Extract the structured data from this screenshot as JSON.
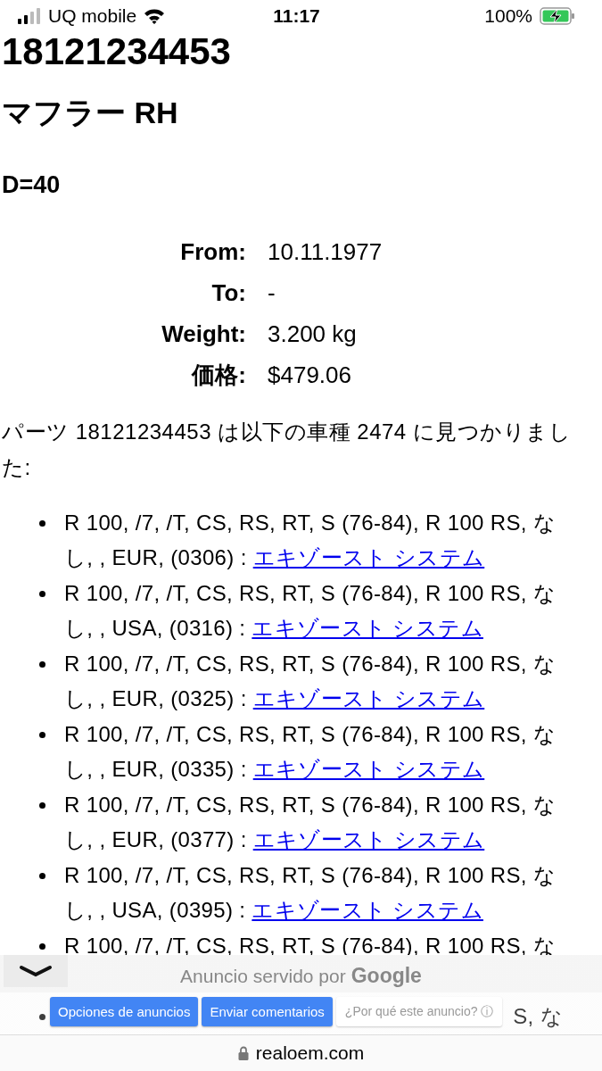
{
  "status_bar": {
    "carrier": "UQ mobile",
    "time": "11:17",
    "battery": "100%"
  },
  "part_number": "18121234453",
  "part_name": "マフラー RH",
  "note": "D=40",
  "details": [
    {
      "label": "From:",
      "value": "10.11.1977"
    },
    {
      "label": "To:",
      "value": "-"
    },
    {
      "label": "Weight:",
      "value": "3.200 kg"
    },
    {
      "label": "価格:",
      "value": "$479.06"
    }
  ],
  "intro": "パーツ 18121234453 は以下の車種 2474 に見つかりました:",
  "models": [
    {
      "text": "R 100, /7, /T, CS, RS, RT, S (76-84), R 100 RS, なし, , EUR, (0306) :",
      "link": "エキゾースト システム "
    },
    {
      "text": "R 100, /7, /T, CS, RS, RT, S (76-84), R 100 RS, なし, , USA, (0316) :",
      "link": "エキゾースト システム "
    },
    {
      "text": "R 100, /7, /T, CS, RS, RT, S (76-84), R 100 RS, なし, , EUR, (0325) :",
      "link": "エキゾースト システム "
    },
    {
      "text": "R 100, /7, /T, CS, RS, RT, S (76-84), R 100 RS, なし, , EUR, (0335) :",
      "link": "エキゾースト システム "
    },
    {
      "text": "R 100, /7, /T, CS, RS, RT, S (76-84), R 100 RS, なし, , EUR, (0377) :",
      "link": "エキゾースト システム "
    },
    {
      "text": "R 100, /7, /T, CS, RS, RT, S (76-84), R 100 RS, なし, , USA, (0395) :",
      "link": "エキゾースト システム "
    },
    {
      "text": "R 100, /7, /T, CS, RS, RT, S (76-84), R 100 RS, な"
    },
    {
      "text": "S, な"
    }
  ],
  "ad_bar": {
    "caption": "Anuncio servido por",
    "brand": "Google",
    "buttons": [
      "Opciones de anuncios",
      "Enviar comentarios"
    ],
    "why": "¿Por qué este anuncio?",
    "info": "ⓘ"
  },
  "address_bar": {
    "domain": "realoem.com"
  }
}
